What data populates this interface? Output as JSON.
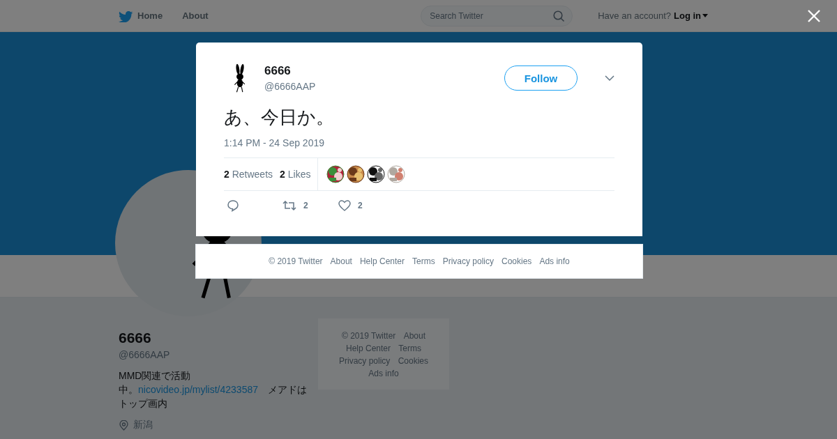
{
  "nav": {
    "items": [
      {
        "label": "Home",
        "kind": "home"
      },
      {
        "label": "About",
        "kind": "plain"
      }
    ],
    "search": {
      "placeholder": "Search Twitter"
    },
    "account": {
      "prompt": "Have an account?",
      "login": "Log in"
    }
  },
  "profile": {
    "name": "6666",
    "handle": "@6666AAP",
    "bio": {
      "before": "MMD関連で活動中。",
      "link": "nicovideo.jp/mylist/4233587",
      "after": "　メアドはトップ画内"
    },
    "location": "新潟"
  },
  "sidebar_footer": {
    "links": [
      "© 2019 Twitter",
      "About",
      "Help Center",
      "Terms",
      "Privacy policy",
      "Cookies",
      "Ads info"
    ]
  },
  "tweet": {
    "name": "6666",
    "handle": "@6666AAP",
    "follow": "Follow",
    "text": "あ、今日か。",
    "timestamp": "1:14 PM - 24 Sep 2019",
    "stats": [
      {
        "count": "2",
        "label": "Retweets"
      },
      {
        "count": "2",
        "label": "Likes"
      }
    ],
    "actions": [
      {
        "kind": "reply"
      },
      {
        "kind": "retweet",
        "count": "2"
      },
      {
        "kind": "like",
        "count": "2"
      }
    ]
  },
  "modal_footer": {
    "links": [
      "© 2019 Twitter",
      "About",
      "Help Center",
      "Terms",
      "Privacy policy",
      "Cookies",
      "Ads info"
    ]
  }
}
